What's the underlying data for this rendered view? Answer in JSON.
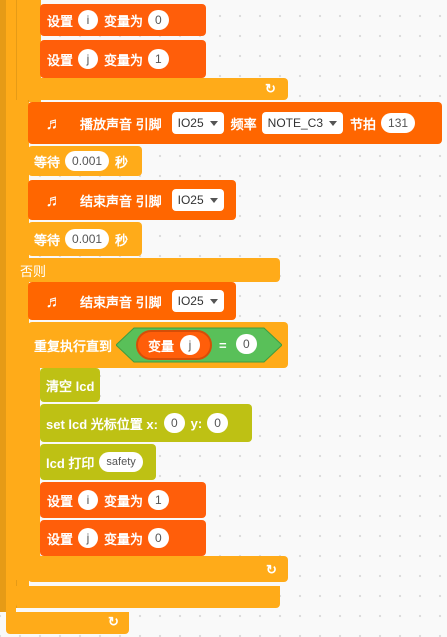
{
  "colors": {
    "canvas": "#f9f9f9",
    "control": "#ffab19",
    "control_dark": "#e69b16",
    "variable": "#ff5e0a",
    "sound": "#ff6600",
    "operator": "#59c059",
    "lcd": "#bec114"
  },
  "loop_icon": "↻",
  "music_icon": "music-note-icon",
  "set_i_0": {
    "prefix": "设置",
    "var": "i",
    "suffix": "变量为",
    "value": "0"
  },
  "set_j_1": {
    "prefix": "设置",
    "var": "j",
    "suffix": "变量为",
    "value": "1"
  },
  "play_tone": {
    "label": "播放声音 引脚",
    "pin": "IO25",
    "freq_label": "频率",
    "note": "NOTE_C3",
    "beat_label": "节拍",
    "beat": "131"
  },
  "wait_1": {
    "label": "等待",
    "value": "0.001",
    "unit": "秒"
  },
  "stop_tone_1": {
    "label": "结束声音 引脚",
    "pin": "IO25"
  },
  "wait_2": {
    "label": "等待",
    "value": "0.001",
    "unit": "秒"
  },
  "else_label": "否则",
  "stop_tone_2": {
    "label": "结束声音 引脚",
    "pin": "IO25"
  },
  "repeat_until": {
    "label": "重复执行直到",
    "var_label": "变量",
    "var": "j",
    "op": "=",
    "value": "0"
  },
  "lcd_clear": {
    "label": "清空 lcd"
  },
  "lcd_cursor": {
    "label": "set lcd 光标位置 x:",
    "x": "0",
    "y_label": "y:",
    "y": "0"
  },
  "lcd_print": {
    "label": "lcd 打印",
    "text": "safety"
  },
  "set_i_1": {
    "prefix": "设置",
    "var": "i",
    "suffix": "变量为",
    "value": "1"
  },
  "set_j_0": {
    "prefix": "设置",
    "var": "j",
    "suffix": "变量为",
    "value": "0"
  }
}
